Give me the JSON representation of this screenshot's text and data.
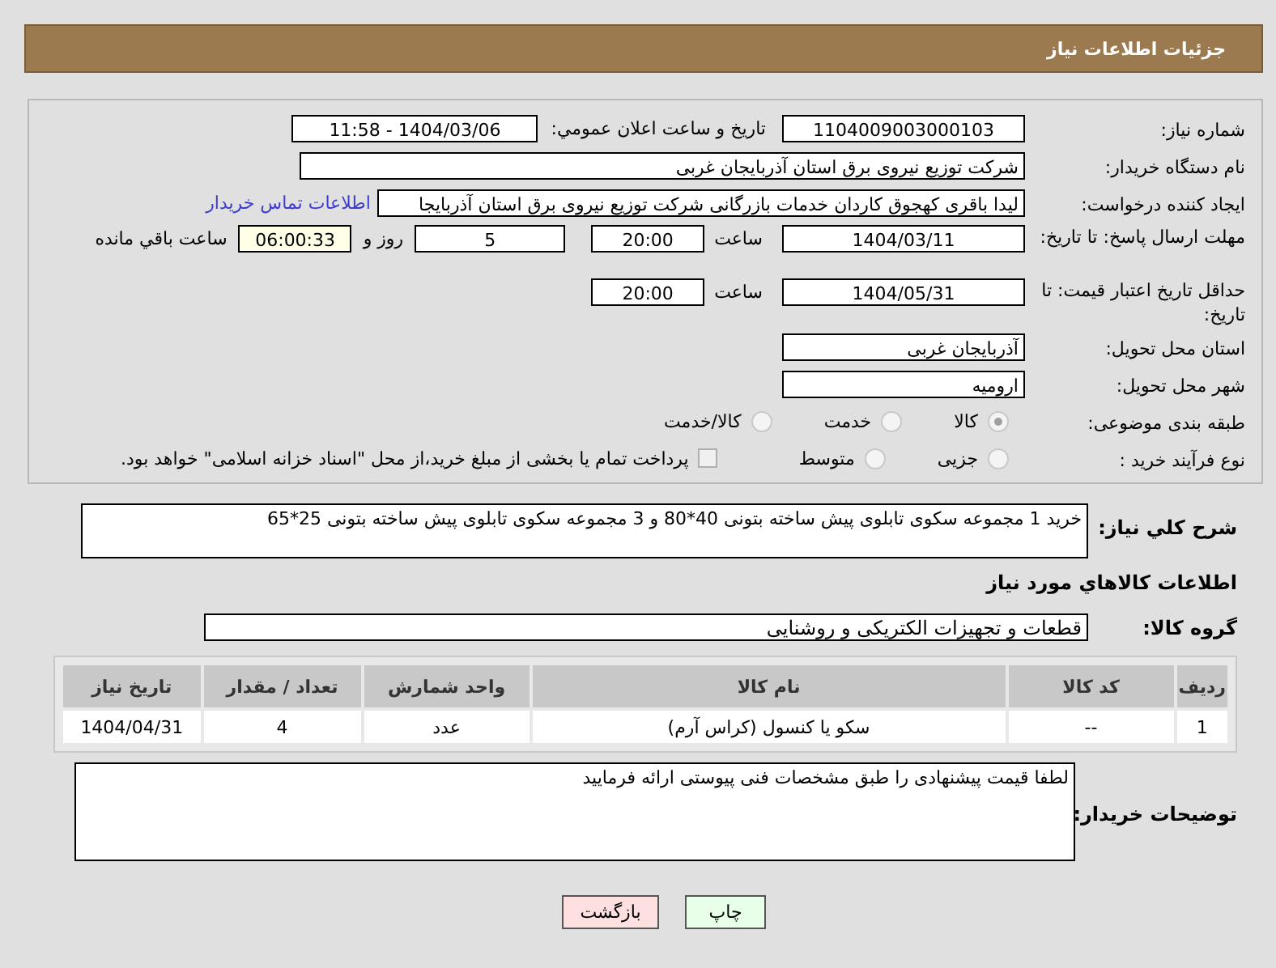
{
  "header": {
    "title": "جزئیات اطلاعات نیاز"
  },
  "form": {
    "need_number": {
      "label": "شماره نیاز:",
      "value": "1104009003000103"
    },
    "announce": {
      "label": "تاریخ و ساعت اعلان عمومي:",
      "value": "1404/03/06 - 11:58"
    },
    "buyer": {
      "label": "نام دستگاه خریدار:",
      "value": "شرکت توزیع نیروی برق استان آذربایجان غربی"
    },
    "requester": {
      "label": "ایجاد کننده درخواست:",
      "value": "لیدا باقری کهجوق کاردان خدمات بازرگانی شرکت توزیع نیروی برق استان آذربایجا",
      "link": "اطلاعات تماس خریدار"
    },
    "deadline": {
      "label": "مهلت ارسال پاسخ: تا تاریخ:",
      "date": "1404/03/11",
      "time_label": "ساعت",
      "time": "20:00",
      "days": "5",
      "days_label": "روز و",
      "remaining": "06:00:33",
      "remaining_label": "ساعت باقي مانده"
    },
    "validity": {
      "label": "حداقل تاریخ اعتبار قیمت: تا تاریخ:",
      "date": "1404/05/31",
      "time_label": "ساعت",
      "time": "20:00"
    },
    "province": {
      "label": "استان محل تحویل:",
      "value": "آذربایجان غربی"
    },
    "city": {
      "label": "شهر محل تحویل:",
      "value": "ارومیه"
    },
    "category": {
      "label": "طبقه بندی موضوعی:",
      "options": [
        {
          "label": "کالا",
          "selected": true
        },
        {
          "label": "خدمت",
          "selected": false
        },
        {
          "label": "کالا/خدمت",
          "selected": false
        }
      ]
    },
    "process": {
      "label": "نوع فرآیند خرید :",
      "options": [
        {
          "label": "جزیی",
          "selected": false
        },
        {
          "label": "متوسط",
          "selected": false
        }
      ],
      "checkbox": {
        "label": "پرداخت تمام یا بخشی از مبلغ خرید،از محل \"اسناد خزانه اسلامی\" خواهد بود.",
        "checked": false
      }
    }
  },
  "description": {
    "label": "شرح کلي نیاز:",
    "value": "خرید 1 مجموعه سکوی تابلوی پیش ساخته  بتونی 40*80 و  3 مجموعه سکوی تابلوی پیش ساخته بتونی 25*65"
  },
  "goods_title": "اطلاعات کالاهاي مورد نیاز",
  "group": {
    "label": "گروه کالا:",
    "value": "قطعات و تجهیزات الکتریکی و روشنایی"
  },
  "table": {
    "columns": [
      "ردیف",
      "کد کالا",
      "نام کالا",
      "واحد شمارش",
      "تعداد / مقدار",
      "تاریخ نیاز"
    ],
    "rows": [
      [
        "1",
        "--",
        "سکو یا کنسول (کراس آرم)",
        "عدد",
        "4",
        "1404/04/31"
      ]
    ]
  },
  "buyer_notes": {
    "label": "توضیحات خریدار:",
    "value": "لطفا قیمت پیشنهادی را طبق مشخصات فنی پیوستی ارائه فرمایید"
  },
  "buttons": [
    {
      "label": "چاپ",
      "kind": "print"
    },
    {
      "label": "بازگشت",
      "kind": "back"
    }
  ]
}
